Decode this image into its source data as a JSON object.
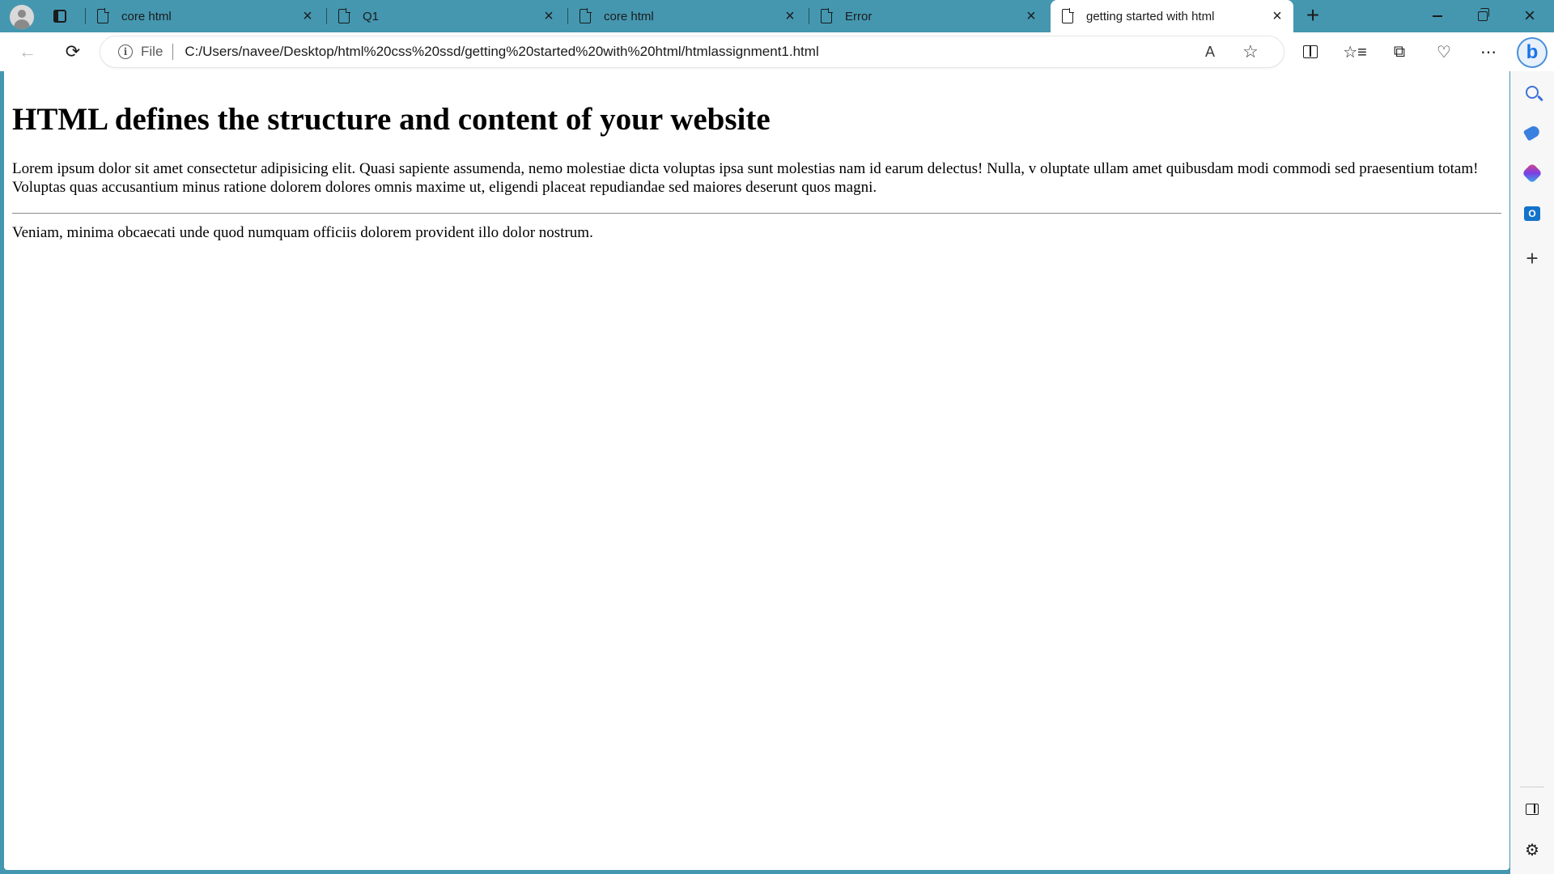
{
  "browser": {
    "tabs": [
      {
        "title": "core html",
        "active": false
      },
      {
        "title": "Q1",
        "active": false
      },
      {
        "title": "core html",
        "active": false
      },
      {
        "title": "Error",
        "active": false
      },
      {
        "title": "getting started with html",
        "active": true
      }
    ],
    "address": {
      "scheme_label": "File",
      "url": "C:/Users/navee/Desktop/html%20css%20ssd/getting%20started%20with%20html/htmlassignment1.html"
    },
    "accent_color": "#4597b0"
  },
  "page": {
    "heading": "HTML defines the structure and content of your website",
    "paragraph1": "Lorem ipsum dolor sit amet consectetur adipisicing elit. Quasi sapiente assumenda, nemo molestiae dicta voluptas ipsa sunt molestias nam id earum delectus! Nulla, v oluptate ullam amet quibusdam modi commodi sed praesentium totam! Voluptas quas accusantium minus ratione dolorem dolores omnis maxime ut, eligendi placeat repudiandae sed maiores deserunt quos magni.",
    "paragraph2": "Veniam, minima obcaecati unde quod numquam officiis dolorem provident illo dolor nostrum."
  },
  "icons": {
    "profile": "profile-icon",
    "tab_actions": "tab-actions-icon",
    "new_tab": "+",
    "close": "×",
    "minimize": "minimize-icon",
    "restore": "restore-icon",
    "window_close": "×",
    "back": "←",
    "refresh": "⟳",
    "read_aloud": "A",
    "favorite": "☆",
    "split_screen": "split-screen-icon",
    "favorites": "☆≡",
    "collections": "⧉",
    "browser_essentials": "♡",
    "more": "⋯",
    "bing": "b",
    "sidebar_add": "+",
    "settings": "⚙"
  }
}
